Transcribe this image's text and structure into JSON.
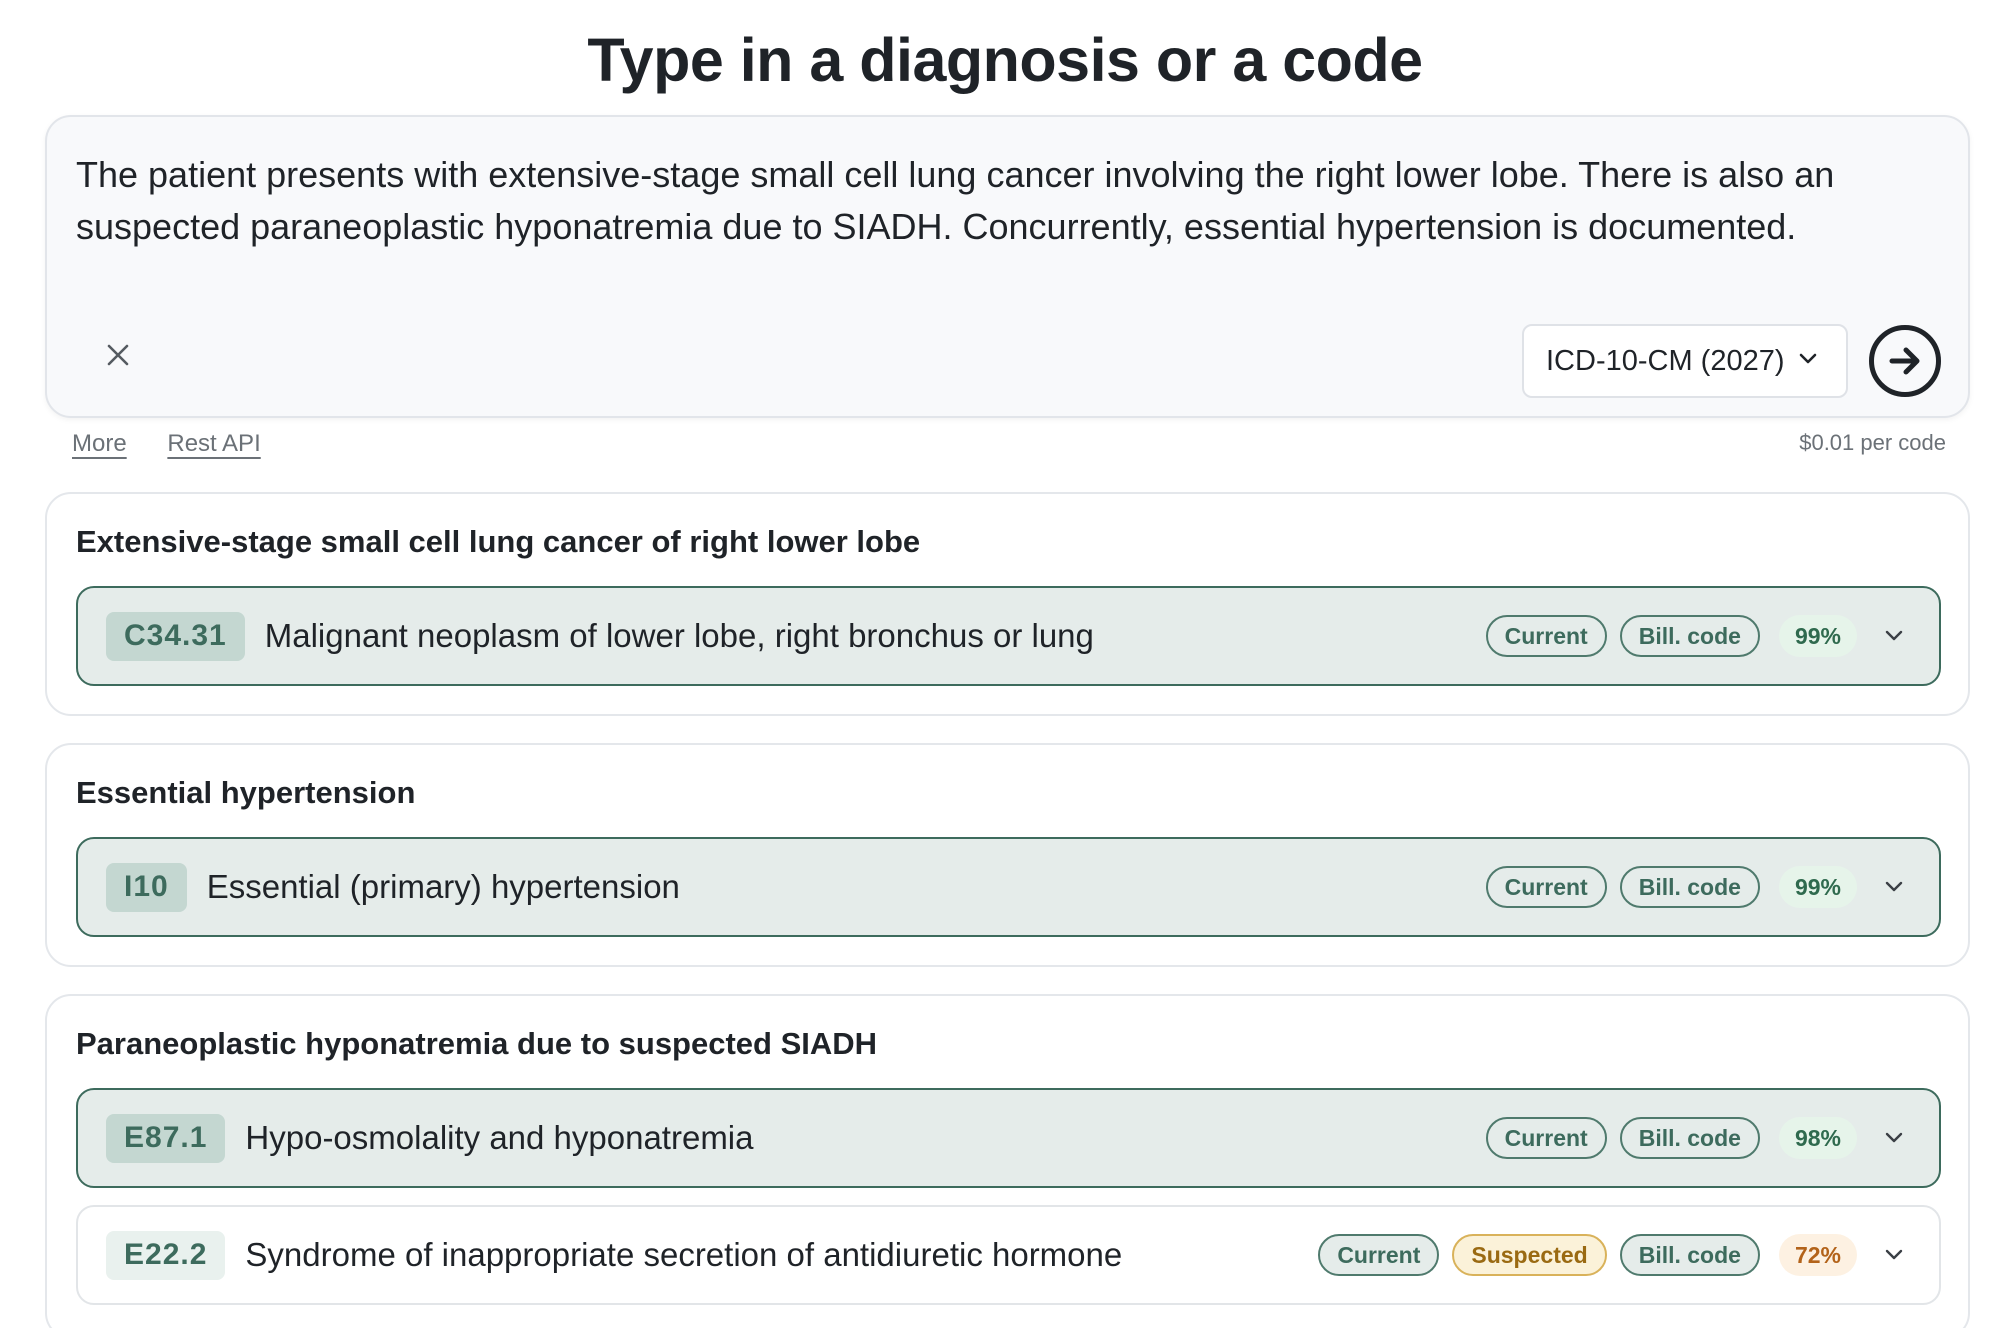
{
  "page": {
    "title": "Type in a diagnosis or a code"
  },
  "query": {
    "text": "The patient presents with extensive-stage small cell lung cancer involving the right lower lobe. There is also an suspected paraneoplastic hyponatremia due to SIADH. Concurrently, essential hypertension is documented.",
    "clear_icon": "close-icon",
    "version_selected": "ICD-10-CM (2027)",
    "submit_icon": "arrow-right-circle-icon"
  },
  "links": {
    "more": "More",
    "rest_api": "Rest API",
    "price": "$0.01 per code"
  },
  "colors": {
    "accent": "#3d6b5d",
    "primary_row_bg": "#e5ecea",
    "suspected": "#9a6a12",
    "pct_high": "#2f6a4e",
    "pct_mid": "#b3631a"
  },
  "groups": [
    {
      "title": "Extensive-stage small cell lung cancer of right lower lobe",
      "codes": [
        {
          "code": "C34.31",
          "description": "Malignant neoplasm of lower lobe, right bronchus or lung",
          "status": "Current",
          "billable": "Bill. code",
          "confidence": "99%"
        }
      ]
    },
    {
      "title": "Essential hypertension",
      "codes": [
        {
          "code": "I10",
          "description": "Essential (primary) hypertension",
          "status": "Current",
          "billable": "Bill. code",
          "confidence": "99%"
        }
      ]
    },
    {
      "title": "Paraneoplastic hyponatremia due to suspected SIADH",
      "codes": [
        {
          "code": "E87.1",
          "description": "Hypo-osmolality and hyponatremia",
          "status": "Current",
          "billable": "Bill. code",
          "confidence": "98%"
        },
        {
          "code": "E22.2",
          "description": "Syndrome of inappropriate secretion of antidiuretic hormone",
          "status": "Current",
          "qualifier": "Suspected",
          "billable": "Bill. code",
          "confidence": "72%"
        }
      ]
    }
  ]
}
